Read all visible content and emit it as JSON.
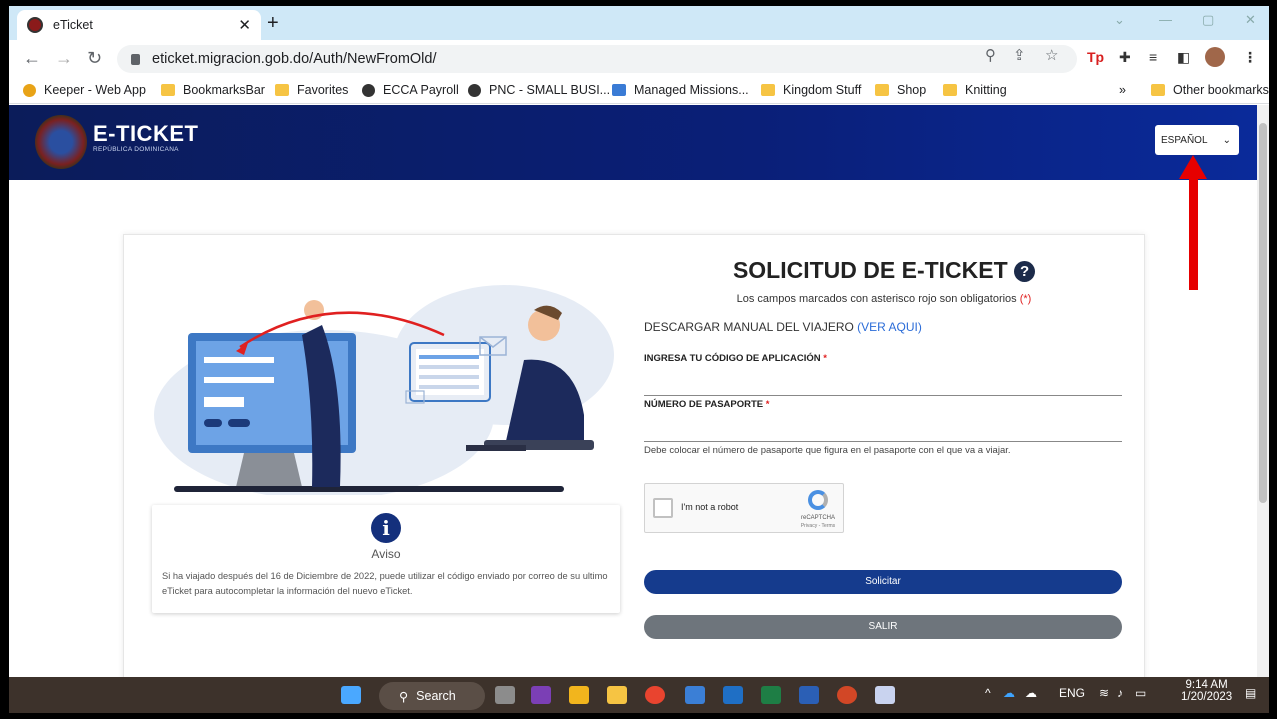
{
  "browser": {
    "tab_title": "eTicket",
    "tab_close": "✕",
    "new_tab": "+",
    "url": "eticket.migracion.gob.do/Auth/NewFromOld/",
    "bookmarks": [
      {
        "label": "Keeper - Web App",
        "icon": "keeper-icon"
      },
      {
        "label": "BookmarksBar",
        "icon": "folder-icon"
      },
      {
        "label": "Favorites",
        "icon": "folder-icon"
      },
      {
        "label": "ECCA Payroll",
        "icon": "globe-icon"
      },
      {
        "label": "PNC - SMALL BUSI...",
        "icon": "globe-icon"
      },
      {
        "label": "Managed Missions...",
        "icon": "site-icon"
      },
      {
        "label": "Kingdom Stuff",
        "icon": "folder-icon"
      },
      {
        "label": "Shop",
        "icon": "folder-icon"
      },
      {
        "label": "Knitting",
        "icon": "folder-icon"
      }
    ],
    "more_bookmarks": "»",
    "other_bookmarks": "Other bookmarks"
  },
  "site": {
    "logo_title": "E-TICKET",
    "logo_subtitle": "REPÚBLICA DOMINICANA",
    "language": "ESPAÑOL"
  },
  "aviso": {
    "icon": "i",
    "title": "Aviso",
    "text": "Si ha viajado después del 16 de Diciembre de 2022, puede utilizar el código enviado por correo de su ultimo eTicket para autocompletar la información del nuevo eTicket."
  },
  "form": {
    "title": "SOLICITUD DE E-TICKET",
    "help_icon": "?",
    "subtitle": "Los campos marcados con asterisco rojo son obligatorios",
    "subtitle_req": "(*)",
    "manual_label": "DESCARGAR MANUAL DEL VIAJERO",
    "manual_link": "(VER AQUI)",
    "code_label": "INGRESA TU CÓDIGO DE APLICACIÓN",
    "passport_label": "NÚMERO DE PASAPORTE",
    "req_mark": "*",
    "passport_hint": "Debe colocar el número de pasaporte que figura en el pasaporte con el que va a viajar.",
    "captcha_label": "I'm not a robot",
    "captcha_brand": "reCAPTCHA",
    "captcha_terms": "Privacy - Terms",
    "submit_label": "Solicitar",
    "exit_label": "SALIR"
  },
  "taskbar": {
    "search_label": "Search",
    "language": "ENG",
    "time": "9:14 AM",
    "date": "1/20/2023"
  },
  "colors": {
    "header_blue": "#0a1f78",
    "primary_button": "#153b8d",
    "secondary_button": "#6e757c",
    "annotation_arrow": "#e60000"
  }
}
